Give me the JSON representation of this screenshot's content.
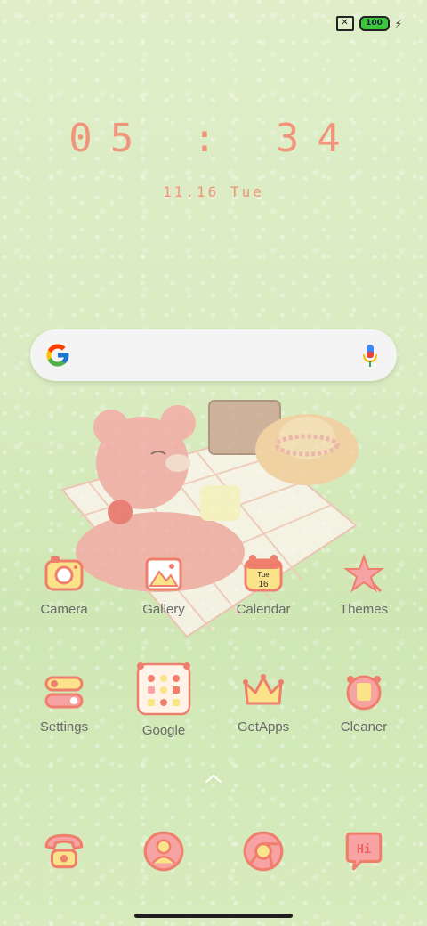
{
  "status": {
    "battery": "100"
  },
  "clock": {
    "time": "05 : 34",
    "date": "11.16 Tue"
  },
  "apps_row1": [
    {
      "label": "Camera"
    },
    {
      "label": "Gallery"
    },
    {
      "label": "Calendar",
      "day": "Tue",
      "num": "16"
    },
    {
      "label": "Themes"
    }
  ],
  "apps_row2": [
    {
      "label": "Settings"
    },
    {
      "label": "Google"
    },
    {
      "label": "GetApps"
    },
    {
      "label": "Cleaner"
    }
  ],
  "dock": {
    "messages_text": "Hi"
  },
  "colors": {
    "accent": "#f2937b",
    "icon_fill": "#fbe38a",
    "wallpaper": "#d9ecc1"
  }
}
